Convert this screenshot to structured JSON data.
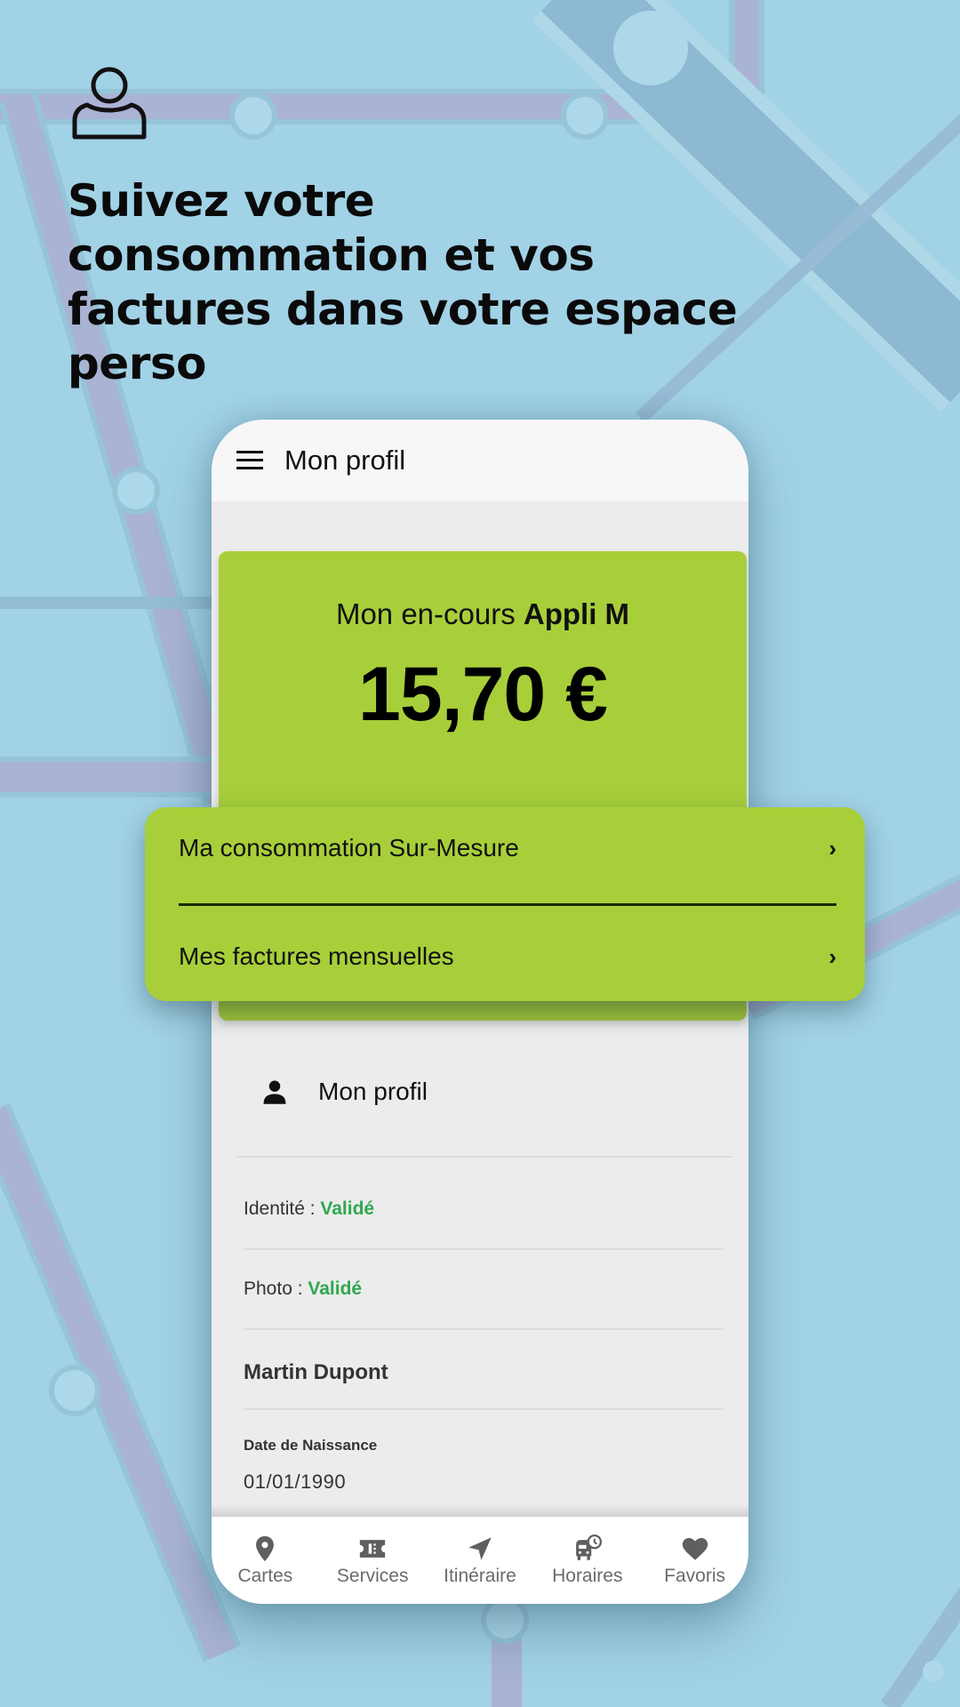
{
  "colors": {
    "background": "#a2d2e6",
    "accent_green": "#a8cf3a",
    "validated_green": "#2fa84f",
    "nav_gray": "#6b6b6b"
  },
  "hero": {
    "icon": "user-outline-icon",
    "title": "Suivez votre consommation et vos factures dans votre espace perso"
  },
  "app": {
    "topbar": {
      "menu_icon": "hamburger-menu-icon",
      "title": "Mon profil"
    },
    "balance_card": {
      "heading_prefix": "Mon en-cours",
      "heading_brand": "Appli M",
      "amount": "15,70 €"
    },
    "popup": {
      "items": [
        {
          "label": "Ma consommation Sur-Mesure",
          "icon": "chevron-right-icon"
        },
        {
          "label": "Mes factures mensuelles",
          "icon": "chevron-right-icon"
        }
      ]
    },
    "profile": {
      "icon": "person-icon",
      "title": "Mon profil",
      "identity_label": "Identité :",
      "identity_status": "Validé",
      "photo_label": "Photo :",
      "photo_status": "Validé",
      "name": "Martin Dupont",
      "dob_label": "Date de Naissance",
      "dob_value": "01/01/1990"
    },
    "bottom_nav": [
      {
        "label": "Cartes",
        "icon": "map-pin-icon"
      },
      {
        "label": "Services",
        "icon": "ticket-icon"
      },
      {
        "label": "Itinéraire",
        "icon": "navigation-arrow-icon"
      },
      {
        "label": "Horaires",
        "icon": "bus-clock-icon"
      },
      {
        "label": "Favoris",
        "icon": "heart-icon"
      }
    ]
  }
}
